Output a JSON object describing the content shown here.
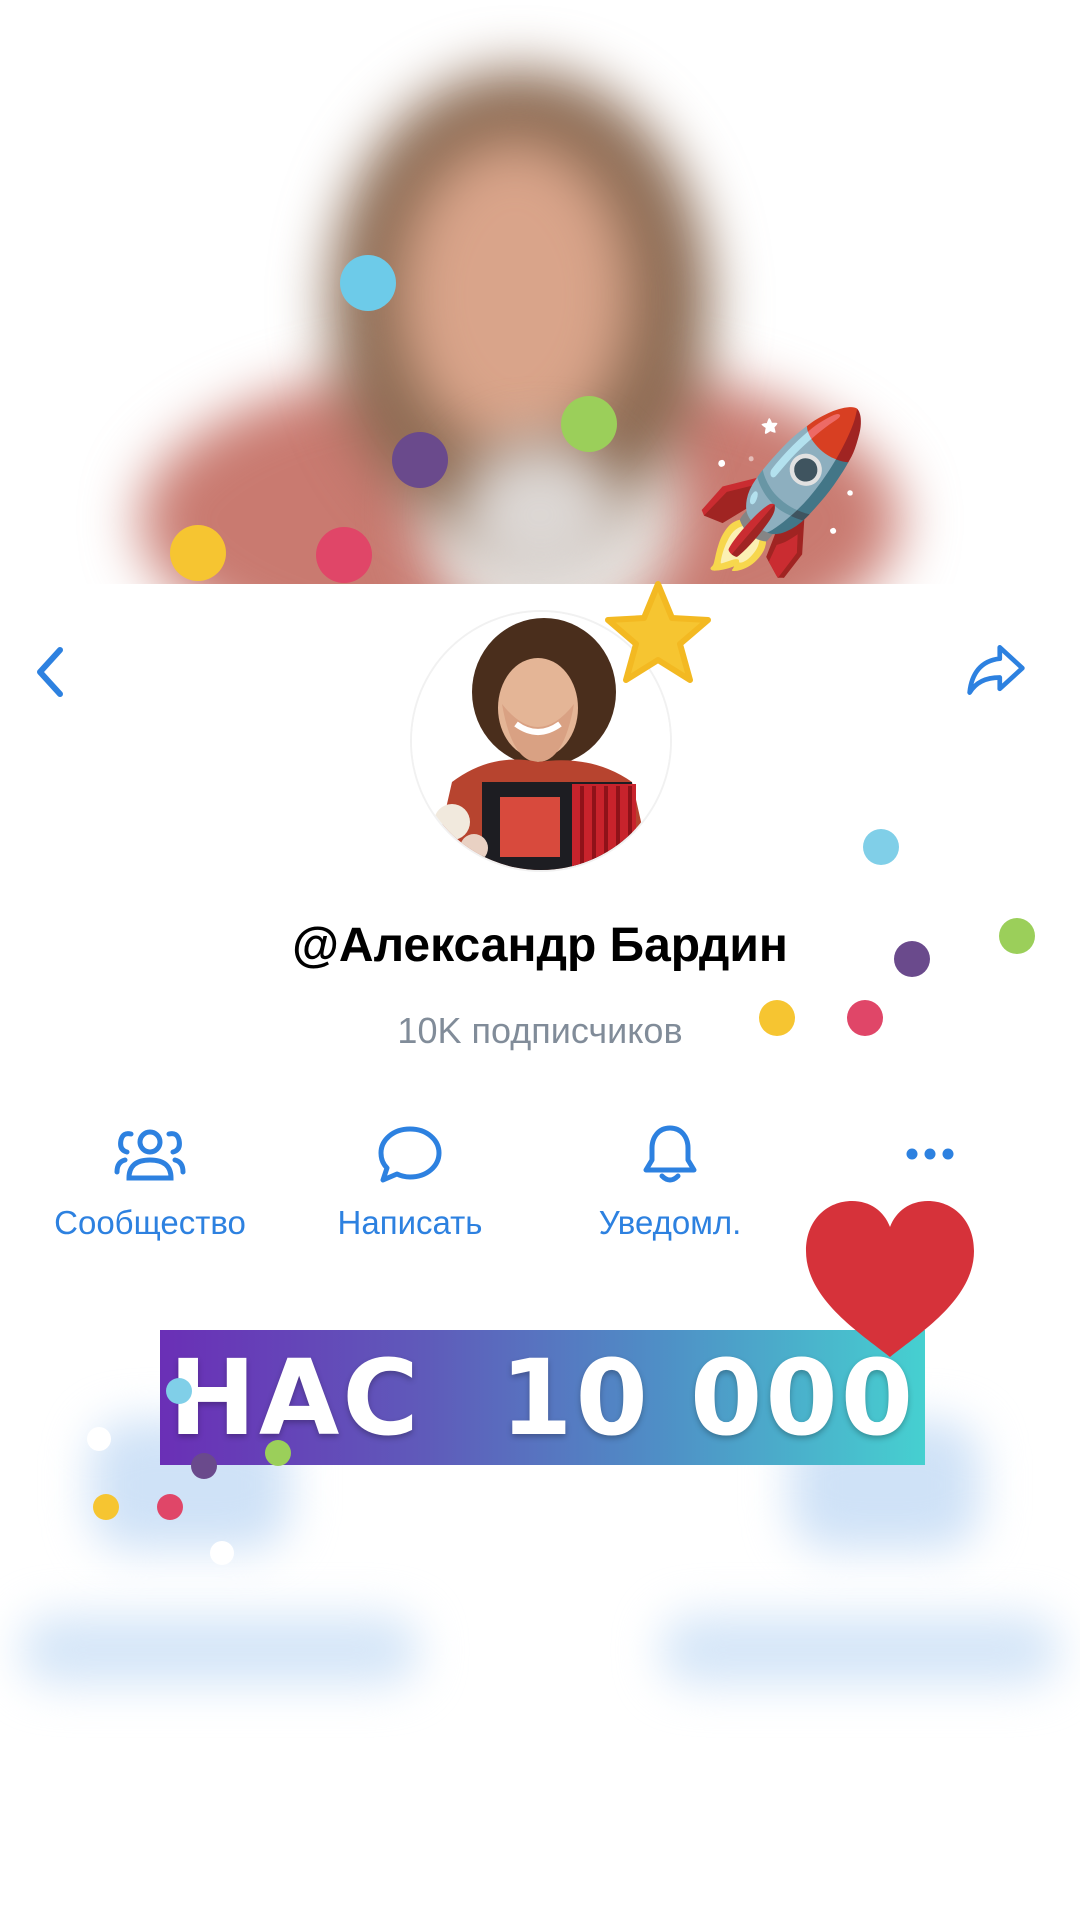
{
  "profile": {
    "name": "@Александр Бардин",
    "subscribers": "10K подписчиков"
  },
  "nav": {
    "back_icon": "chevron-left-icon",
    "share_icon": "share-arrow-icon"
  },
  "actions": [
    {
      "label": "Сообщество",
      "icon": "community-icon"
    },
    {
      "label": "Написать",
      "icon": "message-bubble-icon"
    },
    {
      "label": "Уведомл.",
      "icon": "bell-icon"
    },
    {
      "label": "",
      "icon": "more-dots-icon"
    }
  ],
  "banner": {
    "text": "НАС  10 000"
  },
  "stickers": {
    "rocket": "🚀"
  },
  "colors": {
    "accent": "#2d81e0",
    "secondary_text": "#818c99",
    "heart": "#d6323a",
    "star": "#f6c531"
  }
}
